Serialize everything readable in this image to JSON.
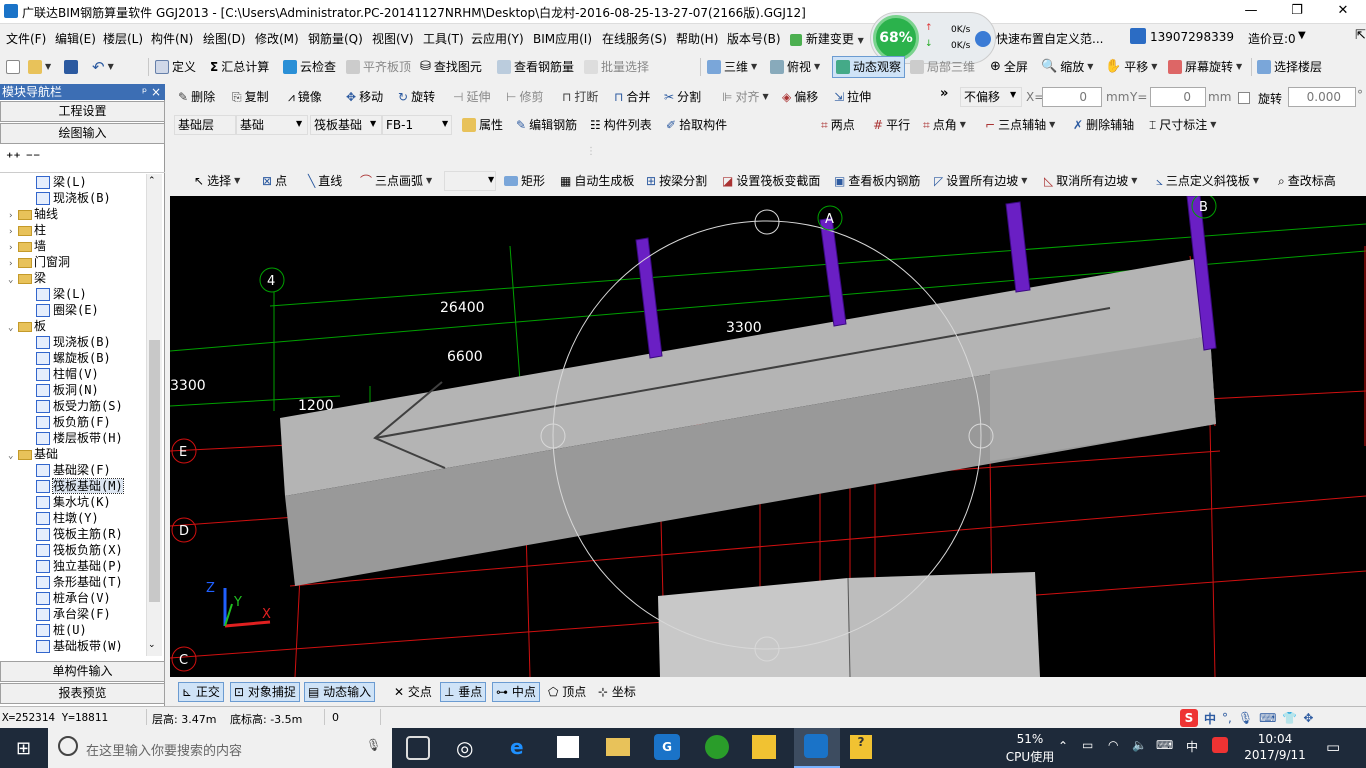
{
  "window": {
    "title": "广联达BIM钢筋算量软件 GGJ2013 - [C:\\Users\\Administrator.PC-20141127NRHM\\Desktop\\白龙村-2016-08-25-13-27-07(2166版).GGJ12]",
    "controls": [
      "—",
      "❐",
      "✕"
    ]
  },
  "menu": [
    "文件(F)",
    "编辑(E)",
    "楼层(L)",
    "构件(N)",
    "绘图(D)",
    "修改(M)",
    "钢筋量(Q)",
    "视图(V)",
    "工具(T)",
    "云应用(Y)",
    "BIM应用(I)",
    "在线服务(S)",
    "帮助(H)",
    "版本号(B)",
    "新建变更"
  ],
  "net_widget": {
    "percent": "68%",
    "up": "0K/s",
    "down": "0K/s"
  },
  "menu_right": {
    "hint": "快速布置自定义范...",
    "phone": "13907298339",
    "price": "造价豆:0"
  },
  "toolbar1": [
    "定义",
    "汇总计算",
    "云检查",
    "平齐板顶",
    "查找图元",
    "查看钢筋量",
    "批量选择",
    "三维",
    "俯视",
    "动态观察",
    "局部三维",
    "全屏",
    "缩放",
    "平移",
    "屏幕旋转",
    "选择楼层"
  ],
  "toolbar2": [
    "删除",
    "复制",
    "镜像",
    "移动",
    "旋转",
    "延伸",
    "修剪",
    "打断",
    "合并",
    "分割",
    "对齐",
    "偏移",
    "拉伸"
  ],
  "offset_fields": {
    "mode": "不偏移",
    "x_label": "X=",
    "x_value": "0",
    "unit": "mm",
    "y_label": "Y=",
    "y_value": "0",
    "rotate_label": "旋转",
    "rotate_value": "0.000",
    "deg": "°"
  },
  "toolbar3": {
    "floor": "基础层",
    "category": "基础",
    "type": "筏板基础",
    "member": "FB-1",
    "props": "属性",
    "edit_rebar": "编辑钢筋",
    "list": "构件列表",
    "pick": "拾取构件"
  },
  "axis_tools": [
    "两点",
    "平行",
    "点角",
    "三点辅轴",
    "删除辅轴",
    "尺寸标注"
  ],
  "draw_tools": [
    "选择",
    "点",
    "直线",
    "三点画弧",
    "矩形",
    "自动生成板",
    "按梁分割",
    "设置筏板变截面",
    "查看板内钢筋",
    "设置所有边坡",
    "取消所有边坡",
    "三点定义斜筏板",
    "查改标高"
  ],
  "sidebar": {
    "header": "模块导航栏",
    "pin": "ᵖ ×",
    "top_buttons": [
      "工程设置",
      "绘图输入"
    ],
    "tree": [
      {
        "indent": 2,
        "kind": "leaf",
        "label": "梁(L)"
      },
      {
        "indent": 2,
        "kind": "leaf",
        "label": "现浇板(B)"
      },
      {
        "indent": 0,
        "kind": "folder",
        "exp": "›",
        "label": "轴线"
      },
      {
        "indent": 0,
        "kind": "folder",
        "exp": "›",
        "label": "柱"
      },
      {
        "indent": 0,
        "kind": "folder",
        "exp": "›",
        "label": "墙"
      },
      {
        "indent": 0,
        "kind": "folder",
        "exp": "›",
        "label": "门窗洞"
      },
      {
        "indent": 0,
        "kind": "folder",
        "exp": "⌄",
        "label": "梁"
      },
      {
        "indent": 2,
        "kind": "leaf",
        "label": "梁(L)"
      },
      {
        "indent": 2,
        "kind": "leaf",
        "label": "圈梁(E)"
      },
      {
        "indent": 0,
        "kind": "folder",
        "exp": "⌄",
        "label": "板"
      },
      {
        "indent": 2,
        "kind": "leaf",
        "label": "现浇板(B)"
      },
      {
        "indent": 2,
        "kind": "leaf",
        "label": "螺旋板(B)"
      },
      {
        "indent": 2,
        "kind": "leaf",
        "label": "柱帽(V)"
      },
      {
        "indent": 2,
        "kind": "leaf",
        "label": "板洞(N)"
      },
      {
        "indent": 2,
        "kind": "leaf",
        "label": "板受力筋(S)"
      },
      {
        "indent": 2,
        "kind": "leaf",
        "label": "板负筋(F)"
      },
      {
        "indent": 2,
        "kind": "leaf",
        "label": "楼层板带(H)"
      },
      {
        "indent": 0,
        "kind": "folder",
        "exp": "⌄",
        "label": "基础"
      },
      {
        "indent": 2,
        "kind": "leaf",
        "label": "基础梁(F)"
      },
      {
        "indent": 2,
        "kind": "leaf",
        "label": "筏板基础(M)",
        "selected": true
      },
      {
        "indent": 2,
        "kind": "leaf",
        "label": "集水坑(K)"
      },
      {
        "indent": 2,
        "kind": "leaf",
        "label": "柱墩(Y)"
      },
      {
        "indent": 2,
        "kind": "leaf",
        "label": "筏板主筋(R)"
      },
      {
        "indent": 2,
        "kind": "leaf",
        "label": "筏板负筋(X)"
      },
      {
        "indent": 2,
        "kind": "leaf",
        "label": "独立基础(P)"
      },
      {
        "indent": 2,
        "kind": "leaf",
        "label": "条形基础(T)"
      },
      {
        "indent": 2,
        "kind": "leaf",
        "label": "桩承台(V)"
      },
      {
        "indent": 2,
        "kind": "leaf",
        "label": "承台梁(F)"
      },
      {
        "indent": 2,
        "kind": "leaf",
        "label": "桩(U)"
      },
      {
        "indent": 2,
        "kind": "leaf",
        "label": "基础板带(W)"
      }
    ],
    "bottom_buttons": [
      "单构件输入",
      "报表预览"
    ]
  },
  "canvas": {
    "dims": [
      "26400",
      "6600",
      "1200",
      "3300",
      "3300"
    ],
    "axis_labels": [
      "4",
      "E",
      "D",
      "C",
      "A",
      "B"
    ],
    "axes3d": [
      "Z",
      "Y",
      "X"
    ]
  },
  "snap": [
    "正交",
    "对象捕捉",
    "动态输入",
    "交点",
    "垂点",
    "中点",
    "顶点",
    "坐标"
  ],
  "status": {
    "coords": "X=252314 Y=18811",
    "floor_height": "层高: 3.47m",
    "base_elev": "底标高: -3.5m",
    "zero": "0"
  },
  "taskbar": {
    "search": "在这里输入你要搜索的内容",
    "cpu_pct": "51%",
    "cpu_label": "CPU使用",
    "ime": "中",
    "time": "10:04",
    "date": "2017/9/11"
  },
  "colors": {
    "grid_green": "#00a000",
    "grid_red": "#d01010",
    "slab_gray": "#b0b0b0",
    "column_purple": "#6a1fc4",
    "nav_blue": "#3c6eb4"
  }
}
